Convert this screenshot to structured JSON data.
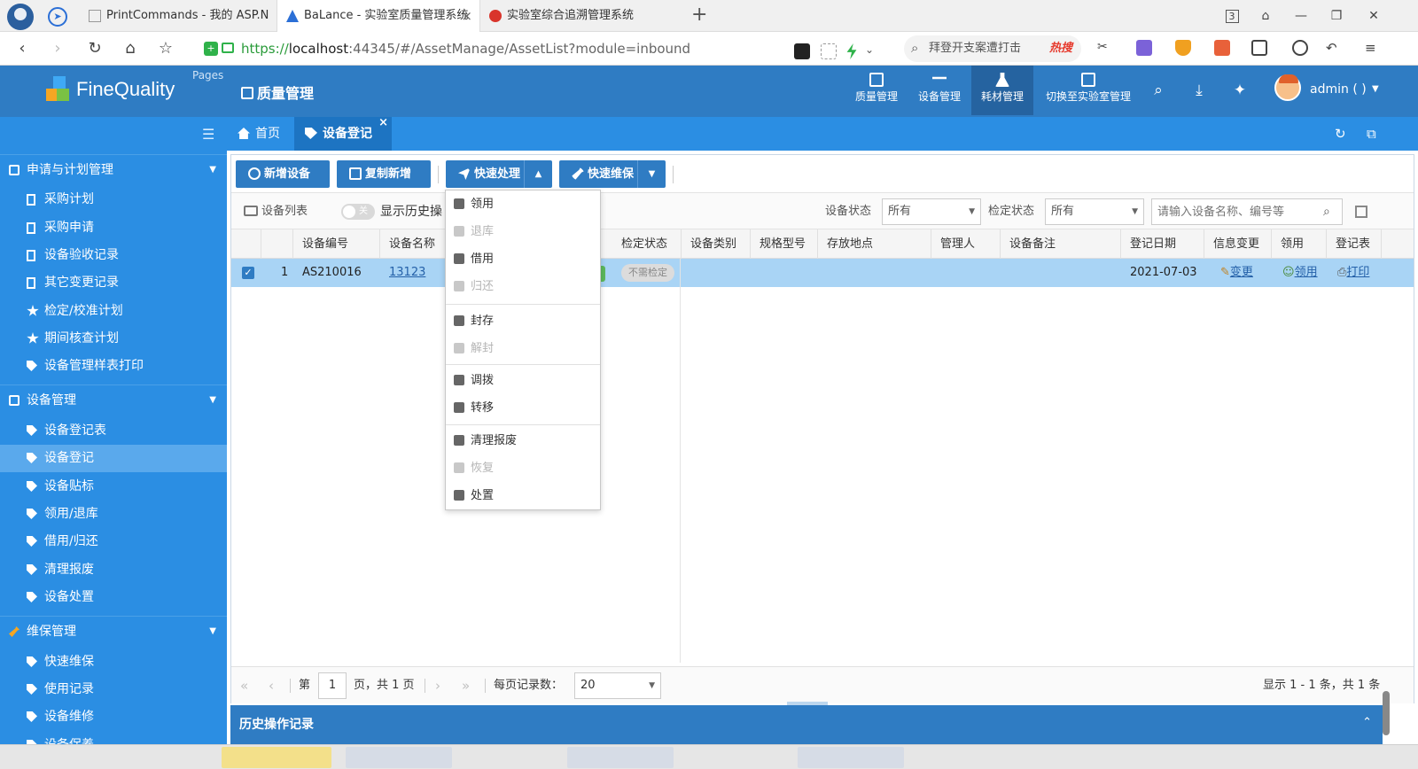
{
  "browser": {
    "tabs": [
      {
        "title": "PrintCommands - 我的 ASP.N"
      },
      {
        "title": "BaLance - 实验室质量管理系统"
      },
      {
        "title": "实验室综合追溯管理系统"
      }
    ],
    "window_badge": "3",
    "url": {
      "protocol": "https://",
      "host": "localhost",
      "rest": ":44345/#/AssetManage/AssetList?module=inbound"
    },
    "search": {
      "text": "拜登开支案遭打击",
      "hot": "热搜"
    }
  },
  "app": {
    "logo": "FineQuality",
    "logo_sub": "Pages",
    "module_title": "质量管理",
    "topnav": [
      {
        "label": "质量管理"
      },
      {
        "label": "设备管理"
      },
      {
        "label": "耗材管理"
      },
      {
        "label": "切换至实验室管理"
      }
    ],
    "user": "admin ( )"
  },
  "sidebar": {
    "groups": [
      {
        "label": "申请与计划管理",
        "items": [
          "采购计划",
          "采购申请",
          "设备验收记录",
          "其它变更记录",
          "检定/校准计划",
          "期间核查计划",
          "设备管理样表打印"
        ]
      },
      {
        "label": "设备管理",
        "items": [
          "设备登记表",
          "设备登记",
          "设备贴标",
          "领用/退库",
          "借用/归还",
          "清理报废",
          "设备处置"
        ]
      },
      {
        "label": "维保管理",
        "items": [
          "快速维保",
          "使用记录",
          "设备维修",
          "设备保养"
        ]
      }
    ],
    "active_item": "设备登记"
  },
  "pagetabs": [
    {
      "label": "首页"
    },
    {
      "label": "设备登记"
    }
  ],
  "toolbar": {
    "add": "新增设备",
    "copy_add": "复制新增",
    "quick_process": "快速处理",
    "quick_maint": "快速维保"
  },
  "filters": {
    "list_label": "设备列表",
    "toggle_text": "关",
    "history_label": "显示历史操",
    "status_label": "设备状态",
    "status_value": "所有",
    "check_label": "检定状态",
    "check_value": "所有",
    "search_placeholder": "请输入设备名称、编号等"
  },
  "grid": {
    "columns": [
      "设备编号",
      "设备名称",
      "检定状态",
      "设备类别",
      "规格型号",
      "存放地点",
      "管理人",
      "设备备注",
      "登记日期",
      "信息变更",
      "领用",
      "登记表"
    ],
    "rows": [
      {
        "index": "1",
        "code": "AS210016",
        "name": "13123",
        "check_status": "不需检定",
        "category": "",
        "spec": "",
        "location": "",
        "manager": "",
        "remark": "",
        "date": "2021-07-03",
        "change": "变更",
        "receive": "领用",
        "print": "打印"
      }
    ]
  },
  "pager": {
    "page_prefix": "第",
    "page": "1",
    "page_suffix": "页，共 1 页",
    "size_label": "每页记录数：",
    "size": "20",
    "summary": "显示 1 - 1 条，共 1 条"
  },
  "history": {
    "title": "历史操作记录"
  },
  "dropdown": {
    "items": [
      {
        "label": "领用",
        "enabled": true
      },
      {
        "label": "退库",
        "enabled": false
      },
      {
        "label": "借用",
        "enabled": true
      },
      {
        "label": "归还",
        "enabled": false
      },
      {
        "label": "封存",
        "enabled": true
      },
      {
        "label": "解封",
        "enabled": false
      },
      {
        "label": "调拨",
        "enabled": true
      },
      {
        "label": "转移",
        "enabled": true
      },
      {
        "label": "清理报废",
        "enabled": true
      },
      {
        "label": "恢复",
        "enabled": false
      },
      {
        "label": "处置",
        "enabled": true
      }
    ]
  },
  "colors": {
    "header": "#2f7cc3",
    "sidebar": "#2b8ee3",
    "row_selected": "#a9d4f5",
    "link": "#2460a8"
  }
}
